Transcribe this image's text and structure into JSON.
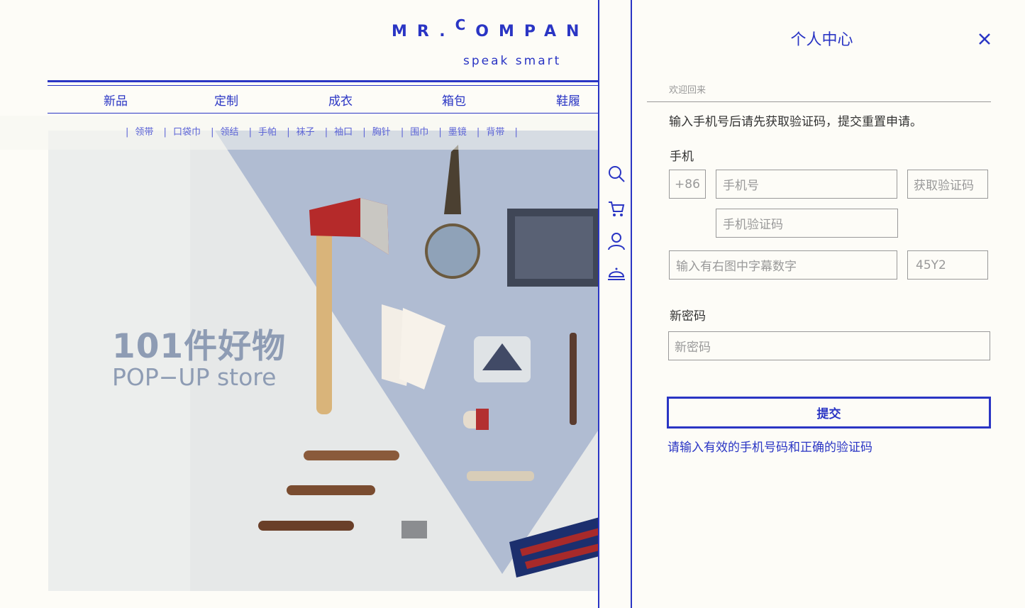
{
  "brand": {
    "logo_pre": "MR.",
    "logo_c": "C",
    "logo_post": "OMPAN",
    "tagline": "speak smart"
  },
  "main_nav": [
    "新品",
    "定制",
    "成衣",
    "箱包",
    "鞋履"
  ],
  "sub_nav": [
    "领带",
    "口袋巾",
    "领结",
    "手帕",
    "袜子",
    "袖口",
    "胸针",
    "围巾",
    "墨镜",
    "背带"
  ],
  "hero": {
    "title": "101件好物",
    "subtitle": "POP−UP store"
  },
  "icons": [
    "search-icon",
    "cart-icon",
    "user-icon",
    "cloche-icon",
    "close-icon"
  ],
  "panel": {
    "title": "个人中心",
    "welcome": "欢迎回来",
    "instruction": "输入手机号后请先获取验证码，提交重置申请。",
    "phone_label": "手机",
    "country_code": "+86",
    "phone_placeholder": "手机号",
    "get_code_label": "获取验证码",
    "sms_code_placeholder": "手机验证码",
    "captcha_placeholder": "输入有右图中字幕数字",
    "captcha_value": "45Y2",
    "new_password_label": "新密码",
    "new_password_placeholder": "新密码",
    "submit_label": "提交",
    "error_message": "请输入有效的手机号码和正确的验证码"
  },
  "colors": {
    "accent": "#2a35c4",
    "hero_bg": "#eceeed",
    "hero_triangle": "#b0bcd2",
    "hero_text": "#8e9cb4"
  }
}
